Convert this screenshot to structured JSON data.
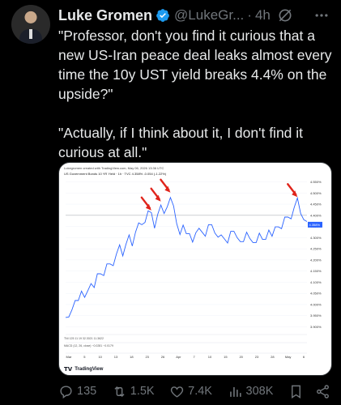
{
  "author": {
    "name": "Luke Gromen",
    "handle": "@LukeGr...",
    "time_sep": "·",
    "time": "4h"
  },
  "tweet": {
    "paragraph1": "\"Professor, don't you find it curious that a new US-Iran peace deal leaks almost every time the 10y UST yield breaks 4.4% on the upside?\"",
    "paragraph2": "\"Actually, if I think about it, I don't find it curious at all.\""
  },
  "chart_header": {
    "line1": "Lukegromen created with TradingView.com, May 06, 2026 13:36 UTC",
    "line2": "US Government Bonds 10 YR Yield · 1h · TVC  4.358%  -0.054  (-1.22%)"
  },
  "chart_footer": {
    "ind1": "TNI 125  11  19  32.3021  11.3622",
    "ind2": "MACD (12, 26, close)  −0.0281  −0.0179",
    "logo": "TradingView"
  },
  "chart_data": {
    "type": "line",
    "title": "US Government Bonds 10 YR Yield",
    "y_ticks": [
      "4.550%",
      "4.500%",
      "4.450%",
      "4.400%",
      "4.350%",
      "4.300%",
      "4.250%",
      "4.200%",
      "4.150%",
      "4.100%",
      "4.050%",
      "4.000%",
      "3.950%",
      "3.900%"
    ],
    "x_ticks": [
      "Mar",
      "5",
      "10",
      "13",
      "18",
      "23",
      "26",
      "Apr",
      "7",
      "10",
      "15",
      "20",
      "23",
      "28",
      "May",
      "6"
    ],
    "ylim": [
      3.88,
      4.57
    ],
    "current_value_label": "4.358%",
    "reference_line": 4.4,
    "series": [
      {
        "values": [
          3.96,
          3.95,
          3.97,
          4.0,
          4.03,
          4.06,
          4.02,
          4.08,
          4.1,
          4.07,
          4.12,
          4.15,
          4.13,
          4.17,
          4.2,
          4.18,
          4.22,
          4.25,
          4.23,
          4.27,
          4.3,
          4.28,
          4.33,
          4.36,
          4.34,
          4.38,
          4.42,
          4.4,
          4.36,
          4.41,
          4.44,
          4.39,
          4.45,
          4.48,
          4.43,
          4.38,
          4.32,
          4.35,
          4.3,
          4.33,
          4.28,
          4.31,
          4.36,
          4.33,
          4.3,
          4.34,
          4.37,
          4.32,
          4.29,
          4.33,
          4.3,
          4.27,
          4.31,
          4.34,
          4.3,
          4.27,
          4.3,
          4.33,
          4.29,
          4.26,
          4.29,
          4.32,
          4.28,
          4.31,
          4.34,
          4.3,
          4.33,
          4.36,
          4.34,
          4.38,
          4.41,
          4.39,
          4.43,
          4.46,
          4.42,
          4.38,
          4.36
        ]
      }
    ],
    "annotations": [
      "arrow",
      "arrow",
      "arrow",
      "arrow"
    ]
  },
  "actions": {
    "replies": "135",
    "reposts": "1.5K",
    "likes": "7.4K",
    "views": "308K"
  },
  "colors": {
    "background": "#000000",
    "text": "#e7e9ea",
    "muted": "#71767b",
    "verified": "#1d9bf0",
    "line": "#2962ff",
    "arrow": "#e0241b"
  }
}
